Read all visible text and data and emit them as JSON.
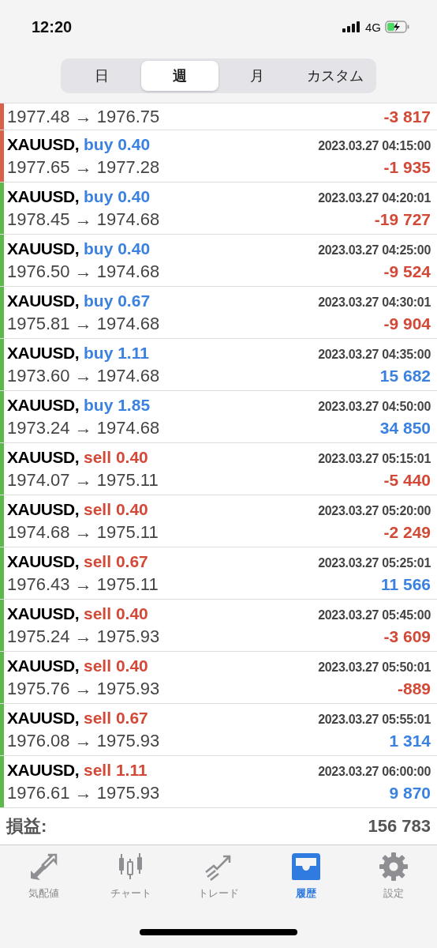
{
  "status_bar": {
    "time": "12:20",
    "network": "4G"
  },
  "segments": [
    {
      "label": "日",
      "selected": false
    },
    {
      "label": "週",
      "selected": true
    },
    {
      "label": "月",
      "selected": false
    },
    {
      "label": "カスタム",
      "selected": false
    }
  ],
  "partial_row": {
    "prices": "1977.48 → 1976.75",
    "profit": "-3 817",
    "loss": true,
    "color": "#d9604a"
  },
  "deals": [
    {
      "symbol": "XAUUSD,",
      "kind": "buy",
      "order": "buy 0.40",
      "time": "2023.03.27 04:15:00",
      "prices": "1977.65 → 1977.28",
      "profit": "-1 935",
      "loss": true,
      "color": "#d9604a"
    },
    {
      "symbol": "XAUUSD,",
      "kind": "buy",
      "order": "buy 0.40",
      "time": "2023.03.27 04:20:01",
      "prices": "1978.45 → 1974.68",
      "profit": "-19 727",
      "loss": true,
      "color": "#5cb84a"
    },
    {
      "symbol": "XAUUSD,",
      "kind": "buy",
      "order": "buy 0.40",
      "time": "2023.03.27 04:25:00",
      "prices": "1976.50 → 1974.68",
      "profit": "-9 524",
      "loss": true,
      "color": "#5cb84a"
    },
    {
      "symbol": "XAUUSD,",
      "kind": "buy",
      "order": "buy 0.67",
      "time": "2023.03.27 04:30:01",
      "prices": "1975.81 → 1974.68",
      "profit": "-9 904",
      "loss": true,
      "color": "#5cb84a"
    },
    {
      "symbol": "XAUUSD,",
      "kind": "buy",
      "order": "buy 1.11",
      "time": "2023.03.27 04:35:00",
      "prices": "1973.60 → 1974.68",
      "profit": "15 682",
      "loss": false,
      "color": "#5cb84a"
    },
    {
      "symbol": "XAUUSD,",
      "kind": "buy",
      "order": "buy 1.85",
      "time": "2023.03.27 04:50:00",
      "prices": "1973.24 → 1974.68",
      "profit": "34 850",
      "loss": false,
      "color": "#5cb84a"
    },
    {
      "symbol": "XAUUSD,",
      "kind": "sell",
      "order": "sell 0.40",
      "time": "2023.03.27 05:15:01",
      "prices": "1974.07 → 1975.11",
      "profit": "-5 440",
      "loss": true,
      "color": "#5cb84a"
    },
    {
      "symbol": "XAUUSD,",
      "kind": "sell",
      "order": "sell 0.40",
      "time": "2023.03.27 05:20:00",
      "prices": "1974.68 → 1975.11",
      "profit": "-2 249",
      "loss": true,
      "color": "#5cb84a"
    },
    {
      "symbol": "XAUUSD,",
      "kind": "sell",
      "order": "sell 0.67",
      "time": "2023.03.27 05:25:01",
      "prices": "1976.43 → 1975.11",
      "profit": "11 566",
      "loss": false,
      "color": "#5cb84a"
    },
    {
      "symbol": "XAUUSD,",
      "kind": "sell",
      "order": "sell 0.40",
      "time": "2023.03.27 05:45:00",
      "prices": "1975.24 → 1975.93",
      "profit": "-3 609",
      "loss": true,
      "color": "#5cb84a"
    },
    {
      "symbol": "XAUUSD,",
      "kind": "sell",
      "order": "sell 0.40",
      "time": "2023.03.27 05:50:01",
      "prices": "1975.76 → 1975.93",
      "profit": "-889",
      "loss": true,
      "color": "#5cb84a"
    },
    {
      "symbol": "XAUUSD,",
      "kind": "sell",
      "order": "sell 0.67",
      "time": "2023.03.27 05:55:01",
      "prices": "1976.08 → 1975.93",
      "profit": "1 314",
      "loss": false,
      "color": "#5cb84a"
    },
    {
      "symbol": "XAUUSD,",
      "kind": "sell",
      "order": "sell 1.11",
      "time": "2023.03.27 06:00:00",
      "prices": "1976.61 → 1975.93",
      "profit": "9 870",
      "loss": false,
      "color": "#5cb84a"
    }
  ],
  "summary": {
    "label": "損益:",
    "value": "156 783"
  },
  "tab_bar": [
    {
      "kind": "quotes",
      "label": "気配値",
      "selected": false
    },
    {
      "kind": "chart",
      "label": "チャート",
      "selected": false
    },
    {
      "kind": "trade",
      "label": "トレード",
      "selected": false
    },
    {
      "kind": "history",
      "label": "履歴",
      "selected": true
    },
    {
      "kind": "settings",
      "label": "設定",
      "selected": false
    }
  ]
}
